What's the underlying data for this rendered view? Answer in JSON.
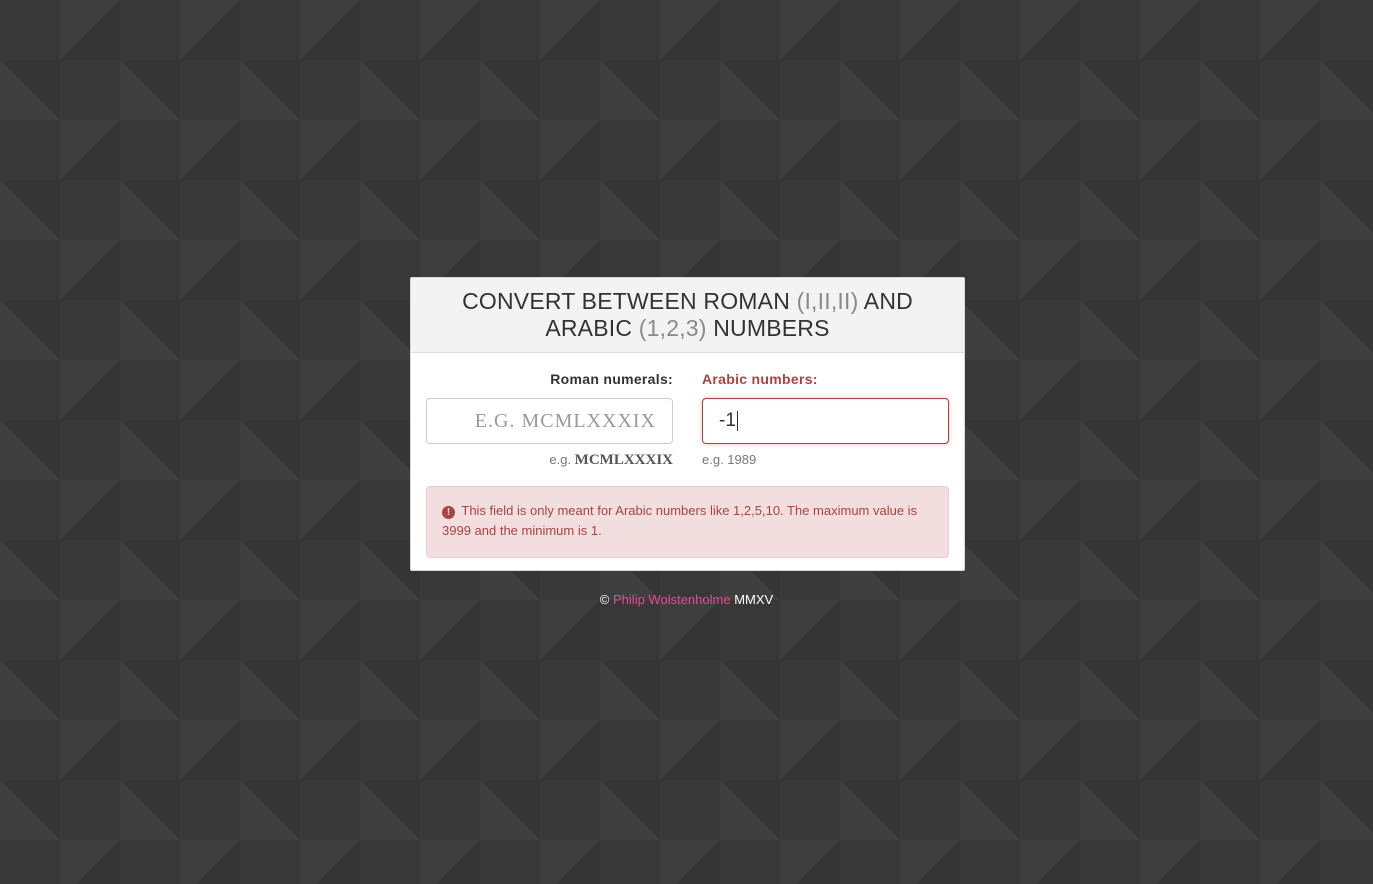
{
  "header": {
    "title_part1": "CONVERT BETWEEN ROMAN ",
    "title_roman_example": "(I,II,II)",
    "title_part2": " AND",
    "title_part3": "ARABIC ",
    "title_arabic_example": "(1,2,3)",
    "title_part4": " NUMBERS"
  },
  "roman": {
    "label": "Roman numerals:",
    "placeholder": "E.G. MCMLXXXIX",
    "value": "",
    "help_prefix": "e.g. ",
    "help_example": "MCMLXXXIX"
  },
  "arabic": {
    "label": "Arabic numbers:",
    "value": "-1",
    "help": "e.g. 1989"
  },
  "alert": {
    "icon": "exclamation-circle-icon",
    "icon_glyph": "!",
    "message": "This field is only meant for Arabic numbers like 1,2,5,10. The maximum value is 3999 and the minimum is 1."
  },
  "footer": {
    "copyright": "©",
    "author": "Philip Wolstenholme",
    "year": "MMXV"
  },
  "colors": {
    "error": "#a94442",
    "error_bg": "#f2dede",
    "link": "#e94893",
    "background": "#383838"
  }
}
